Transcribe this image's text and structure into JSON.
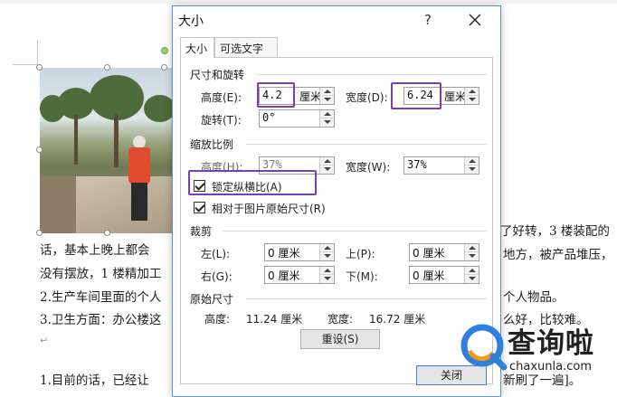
{
  "document": {
    "lines": [
      "话，基本上晚上都会",
      "没有摆放，1 楼精加工",
      "2.生产车间里面的个人",
      "3.卫生方面：办公楼这",
      "1.目前的话，已经让",
      "了好转，3 楼装配的",
      "地方，被产品堆压，",
      "个人物品。",
      "么好，比较难。",
      "新刷了一遍]。"
    ]
  },
  "dialog": {
    "title": "大小",
    "help": "?",
    "tabs": [
      "大小",
      "可选文字"
    ],
    "size_rotate": {
      "section": "尺寸和旋转",
      "height_label": "高度(E):",
      "height_value": "4.2",
      "height_unit": "厘米",
      "width_label": "宽度(D):",
      "width_value": "6.24",
      "width_unit": "厘米",
      "rotate_label": "旋转(T):",
      "rotate_value": "0°"
    },
    "scale": {
      "section": "缩放比例",
      "height_label": "高度(H):",
      "height_value": "37%",
      "width_label": "宽度(W):",
      "width_value": "37%",
      "lock_label": "锁定纵横比(A)",
      "relative_label": "相对于图片原始尺寸(R)"
    },
    "crop": {
      "section": "裁剪",
      "left_label": "左(L):",
      "left_value": "0 厘米",
      "top_label": "上(P):",
      "top_value": "0 厘米",
      "right_label": "右(G):",
      "right_value": "0 厘米",
      "bottom_label": "下(M):",
      "bottom_value": "0 厘米"
    },
    "original": {
      "section": "原始尺寸",
      "height_label": "高度:",
      "height_value": "11.24 厘米",
      "width_label": "宽度:",
      "width_value": "16.72 厘米"
    },
    "reset_button": "重设(S)",
    "close_button": "关闭"
  },
  "watermark": {
    "cn": "查询啦",
    "en": "chaxunla.com"
  },
  "colors": {
    "highlight": "#7b3db3",
    "dialog_border": "#5b8fd1",
    "watermark_blue": "#2f7fe0",
    "watermark_orange": "#f29a1a"
  }
}
